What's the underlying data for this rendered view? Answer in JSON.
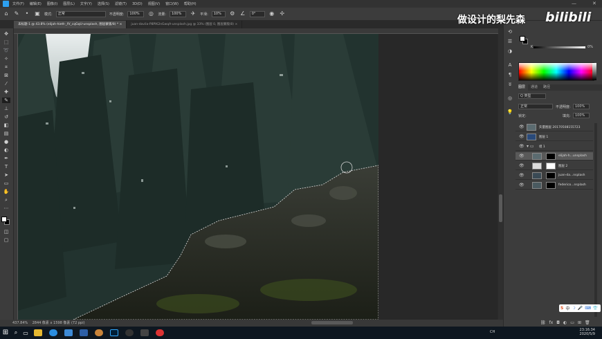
{
  "menubar": {
    "items": [
      "文件(F)",
      "编辑(E)",
      "图像(I)",
      "图层(L)",
      "文字(Y)",
      "选择(S)",
      "滤镜(T)",
      "3D(D)",
      "视图(V)",
      "窗口(W)",
      "帮助(H)"
    ],
    "minimize": "—",
    "close": "✕"
  },
  "options": {
    "mode_label": "模式:",
    "mode_value": "正常",
    "opacity_label": "不透明度:",
    "opacity_value": "100%",
    "flow_label": "流量:",
    "flow_value": "100%",
    "smooth_label": "平滑:",
    "smooth_value": "10%",
    "angle_value": "0°"
  },
  "tabs": [
    {
      "label": "未标题-1 @ 43.8% (elijah-hiett-_fV_cqGqU-unsplash, 图层蒙版/8) * ×"
    },
    {
      "label": "juan-davila-P8PlK2nGwqA-unsplash.jpg @ 33% (图层 0, 图层蒙版/8) ×"
    }
  ],
  "status": {
    "zoom": "437.84%",
    "doc_size": "2844 像素 x 1598 像素 (72 ppi)"
  },
  "watermark": {
    "cn_text": "做设计的梨先森",
    "bili_text": "bilibili"
  },
  "color_panel": {
    "slider_label": "K",
    "slider_value": "0",
    "slider_pct": "%"
  },
  "layers_panel": {
    "tabs": [
      "图层",
      "通道",
      "路径"
    ],
    "filter": "Q 类型",
    "blend_mode": "正常",
    "opacity_label": "不透明度:",
    "opacity_value": "100%",
    "lock_label": "锁定:",
    "fill_label": "填充:",
    "fill_value": "100%",
    "layers": [
      {
        "name": "矢量图层 20170508155723",
        "selected": false,
        "mask": false
      },
      {
        "name": "图层 1",
        "selected": false,
        "mask": false
      },
      {
        "name": "组 1",
        "selected": false,
        "mask": false
      },
      {
        "name": "elijah-h...unsplash",
        "selected": true,
        "mask": true
      },
      {
        "name": "图层 2",
        "selected": false,
        "mask": true
      },
      {
        "name": "juan-da...nsplash",
        "selected": false,
        "mask": true
      },
      {
        "name": "federico...nsplash",
        "selected": false,
        "mask": true
      }
    ]
  },
  "ime": {
    "lang": "中"
  },
  "taskbar": {
    "time": "23:16:34",
    "date": "2020/5/9",
    "lang": "CH"
  }
}
